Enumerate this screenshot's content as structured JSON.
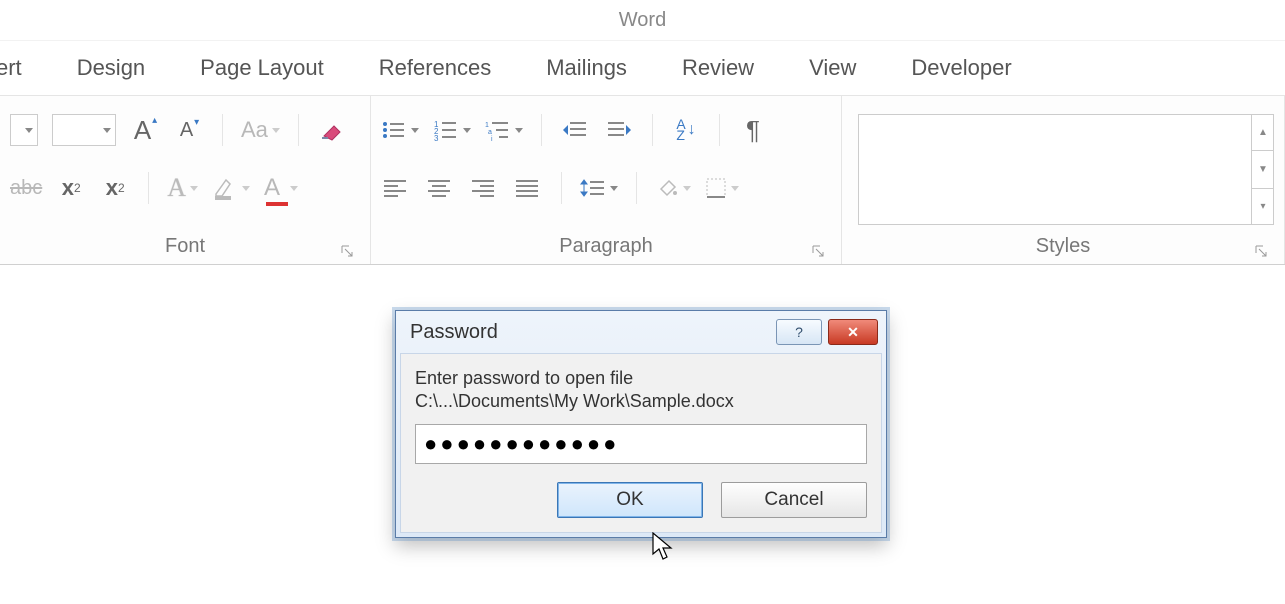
{
  "app": {
    "title": "Word"
  },
  "tabs": {
    "t0": "ert",
    "t1": "Design",
    "t2": "Page Layout",
    "t3": "References",
    "t4": "Mailings",
    "t5": "Review",
    "t6": "View",
    "t7": "Developer"
  },
  "ribbon": {
    "font_group": "Font",
    "paragraph_group": "Paragraph",
    "styles_group": "Styles",
    "grow_font": "A",
    "shrink_font": "A",
    "change_case": "Aa",
    "strike": "abc",
    "sub": "x",
    "sup": "x",
    "text_effects": "A",
    "highlight": "ab",
    "font_color": "A",
    "sort_label": "A",
    "sort_label2": "Z",
    "pilcrow": "¶"
  },
  "dialog": {
    "title": "Password",
    "line1": "Enter password to open file",
    "line2": "C:\\...\\Documents\\My Work\\Sample.docx",
    "password_value": "●●●●●●●●●●●●",
    "ok": "OK",
    "cancel": "Cancel"
  }
}
